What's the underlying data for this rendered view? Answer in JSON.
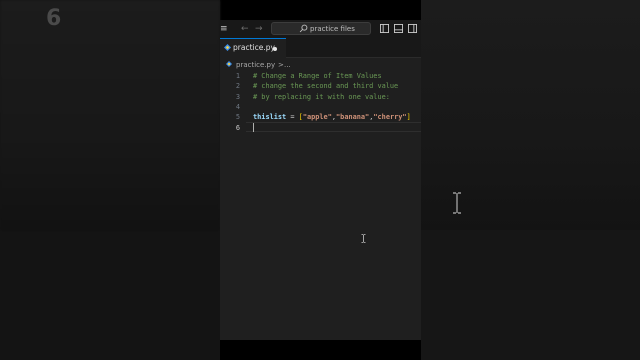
{
  "overlay_number": "6",
  "titlebar": {
    "menu_glyph": "≡",
    "back_arrow": "←",
    "forward_arrow": "→",
    "search_text": "practice files",
    "search_icon": "search-icon",
    "layout_icons": [
      "toggle-primary-sidebar-icon",
      "toggle-panel-icon",
      "toggle-secondary-sidebar-icon"
    ]
  },
  "tab": {
    "label": "practice.py",
    "icon": "python-file-icon",
    "unsaved": true
  },
  "breadcrumb": {
    "file": "practice.py",
    "separator": ">",
    "more": "..."
  },
  "editor": {
    "active_line": 6,
    "lines": [
      {
        "number": "1",
        "text": "# Change a Range of Item Values"
      },
      {
        "number": "2",
        "text": "# change the second and third value"
      },
      {
        "number": "3",
        "text": "# by replacing it with one value:"
      },
      {
        "number": "4",
        "text": ""
      },
      {
        "number": "5",
        "var": "thislist",
        "eq": " = ",
        "open": "[",
        "s1": "\"apple\"",
        "c1": ",",
        "s2": "\"banana\"",
        "c2": ",",
        "s3": "\"cherry\"",
        "close": "]"
      },
      {
        "number": "6",
        "text": ""
      }
    ]
  },
  "colors": {
    "editor_bg": "#1f1f1f",
    "comment": "#6a9955",
    "string": "#ce9178",
    "variable": "#9cdcfe",
    "bracket": "#ffd700",
    "accent": "#0078d4"
  }
}
